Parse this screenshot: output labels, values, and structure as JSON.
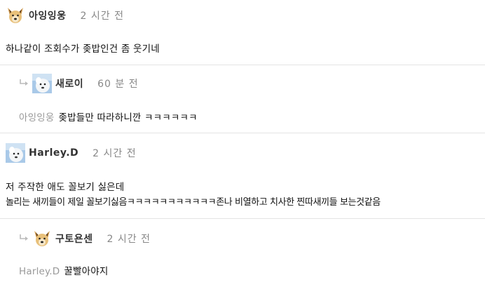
{
  "comments": [
    {
      "nickname": "아잉잉웅",
      "time": "2 시간 전",
      "avatar_icon": "dog-face-icon",
      "lines": [
        "하나같이 조회수가 좆밥인건 좀 웃기네"
      ]
    },
    {
      "nickname": "새로이",
      "time": "60 분 전",
      "avatar_icon": "white-dog-photo-icon",
      "reply_to": "아잉잉웅",
      "text": "좆밥들만 따라하니깐 ㅋㅋㅋㅋㅋㅋ"
    },
    {
      "nickname": "Harley.D",
      "time": "2 시간 전",
      "avatar_icon": "white-dog-photo-icon",
      "lines": [
        "저 주작한 애도 꼴보기 싫은데",
        "놀리는 새끼들이 제일 꼴보기싫음ㅋㅋㅋㅋㅋㅋㅋㅋㅋㅋㅋ존나 비열하고 치사한 찐따새끼들 보는것같음"
      ]
    },
    {
      "nickname": "구토욘센",
      "time": "2 시간 전",
      "avatar_icon": "dog-face-icon",
      "reply_to": "Harley.D",
      "text": "꿀빨아야지"
    }
  ],
  "colors": {
    "separator": "#e4e4e4",
    "time": "#888888",
    "mention": "#999999",
    "reply_arrow": "#bbbbbb"
  }
}
